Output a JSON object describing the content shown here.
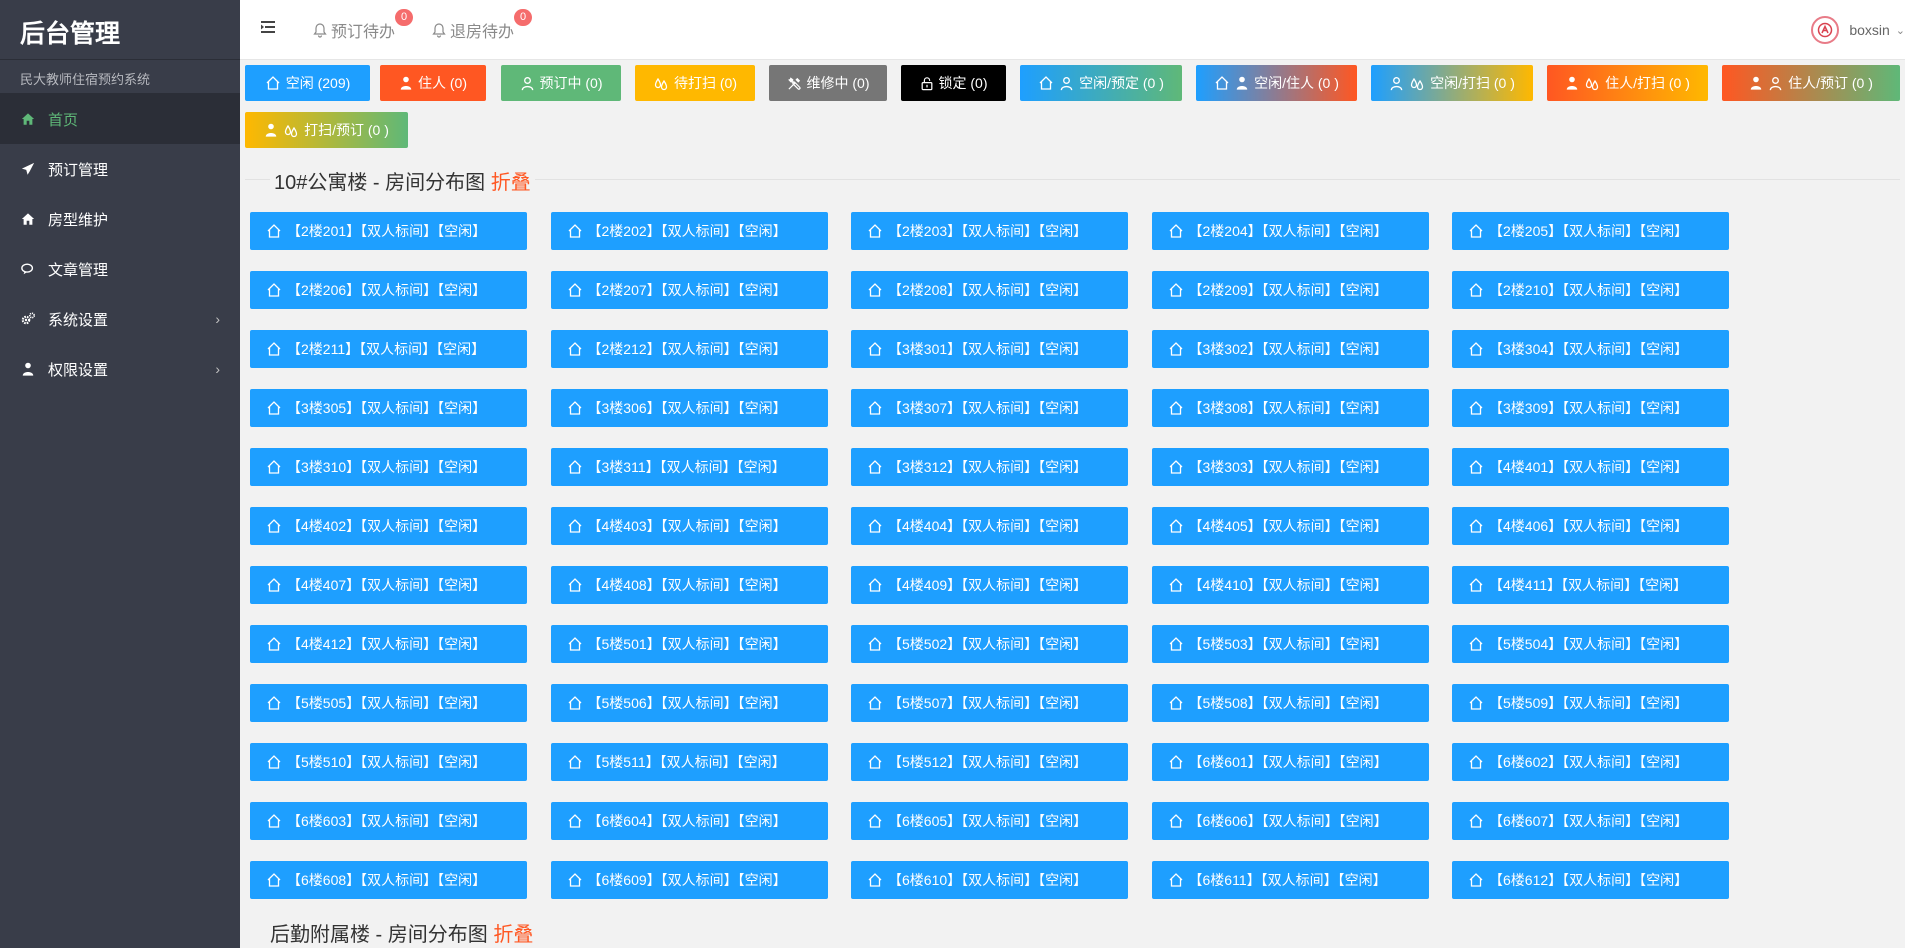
{
  "sidebar": {
    "brand": "后台管理",
    "subtitle": "民大教师住宿预约系统",
    "items": [
      {
        "label": "首页",
        "icon": "home-icon",
        "active": true,
        "has_arrow": false
      },
      {
        "label": "预订管理",
        "icon": "send-icon",
        "active": false,
        "has_arrow": false
      },
      {
        "label": "房型维护",
        "icon": "home-icon",
        "active": false,
        "has_arrow": false
      },
      {
        "label": "文章管理",
        "icon": "chat-icon",
        "active": false,
        "has_arrow": false
      },
      {
        "label": "系统设置",
        "icon": "gears-icon",
        "active": false,
        "has_arrow": true
      },
      {
        "label": "权限设置",
        "icon": "person-icon",
        "active": false,
        "has_arrow": true
      }
    ],
    "arrow": "›"
  },
  "topbar": {
    "todos": [
      {
        "label": "预订待办",
        "count": "0"
      },
      {
        "label": "退房待办",
        "count": "0"
      }
    ],
    "username": "boxsin",
    "caret": "⌄"
  },
  "legend": [
    {
      "label": "空闲 (209)",
      "icons": [
        "house-icon"
      ],
      "bg": "#1e9fff"
    },
    {
      "label": "住人 (0)",
      "icons": [
        "person-icon"
      ],
      "bg": "#ff5722"
    },
    {
      "label": "预订中 (0)",
      "icons": [
        "user-outline-icon"
      ],
      "bg": "#5fb878"
    },
    {
      "label": "待打扫 (0)",
      "icons": [
        "drops-icon"
      ],
      "bg": "#ffb800"
    },
    {
      "label": "维修中 (0)",
      "icons": [
        "tools-icon"
      ],
      "bg": "#767676"
    },
    {
      "label": "锁定 (0)",
      "icons": [
        "lock-icon"
      ],
      "bg": "#000000"
    },
    {
      "label": "空闲/预定 (0 )",
      "icons": [
        "house-icon",
        "user-outline-icon"
      ],
      "bg": "linear-gradient(to right,#1e9fff,#5fb878)"
    },
    {
      "label": "空闲/住人 (0 )",
      "icons": [
        "house-icon",
        "person-icon"
      ],
      "bg": "linear-gradient(to right,#1e9fff,#ff5722)"
    },
    {
      "label": "空闲/打扫 (0 )",
      "icons": [
        "user-outline-icon",
        "drops-icon"
      ],
      "bg": "linear-gradient(to right,#1e9fff,#ffb800)"
    },
    {
      "label": "住人/打扫 (0 )",
      "icons": [
        "person-icon",
        "drops-icon"
      ],
      "bg": "linear-gradient(to right,#ff5722,#ffb800)"
    },
    {
      "label": "住人/预订 (0 )",
      "icons": [
        "person-icon",
        "user-outline-icon"
      ],
      "bg": "linear-gradient(to right,#ff5722,#5fb878)"
    },
    {
      "label": "打扫/预订 (0 )",
      "icons": [
        "person-icon",
        "drops-icon"
      ],
      "bg": "linear-gradient(to right,#ffb800,#5fb878)"
    }
  ],
  "sections": [
    {
      "title": "10#公寓楼 - 房间分布图 ",
      "fold": "折叠"
    },
    {
      "title": "后勤附属楼 - 房间分布图 ",
      "fold": "折叠"
    }
  ],
  "rooms": [
    "【2楼201】【双人标间】【空闲】",
    "【2楼202】【双人标间】【空闲】",
    "【2楼203】【双人标间】【空闲】",
    "【2楼204】【双人标间】【空闲】",
    "【2楼205】【双人标间】【空闲】",
    "【2楼206】【双人标间】【空闲】",
    "【2楼207】【双人标间】【空闲】",
    "【2楼208】【双人标间】【空闲】",
    "【2楼209】【双人标间】【空闲】",
    "【2楼210】【双人标间】【空闲】",
    "【2楼211】【双人标间】【空闲】",
    "【2楼212】【双人标间】【空闲】",
    "【3楼301】【双人标间】【空闲】",
    "【3楼302】【双人标间】【空闲】",
    "【3楼304】【双人标间】【空闲】",
    "【3楼305】【双人标间】【空闲】",
    "【3楼306】【双人标间】【空闲】",
    "【3楼307】【双人标间】【空闲】",
    "【3楼308】【双人标间】【空闲】",
    "【3楼309】【双人标间】【空闲】",
    "【3楼310】【双人标间】【空闲】",
    "【3楼311】【双人标间】【空闲】",
    "【3楼312】【双人标间】【空闲】",
    "【3楼303】【双人标间】【空闲】",
    "【4楼401】【双人标间】【空闲】",
    "【4楼402】【双人标间】【空闲】",
    "【4楼403】【双人标间】【空闲】",
    "【4楼404】【双人标间】【空闲】",
    "【4楼405】【双人标间】【空闲】",
    "【4楼406】【双人标间】【空闲】",
    "【4楼407】【双人标间】【空闲】",
    "【4楼408】【双人标间】【空闲】",
    "【4楼409】【双人标间】【空闲】",
    "【4楼410】【双人标间】【空闲】",
    "【4楼411】【双人标间】【空闲】",
    "【4楼412】【双人标间】【空闲】",
    "【5楼501】【双人标间】【空闲】",
    "【5楼502】【双人标间】【空闲】",
    "【5楼503】【双人标间】【空闲】",
    "【5楼504】【双人标间】【空闲】",
    "【5楼505】【双人标间】【空闲】",
    "【5楼506】【双人标间】【空闲】",
    "【5楼507】【双人标间】【空闲】",
    "【5楼508】【双人标间】【空闲】",
    "【5楼509】【双人标间】【空闲】",
    "【5楼510】【双人标间】【空闲】",
    "【5楼511】【双人标间】【空闲】",
    "【5楼512】【双人标间】【空闲】",
    "【6楼601】【双人标间】【空闲】",
    "【6楼602】【双人标间】【空闲】",
    "【6楼603】【双人标间】【空闲】",
    "【6楼604】【双人标间】【空闲】",
    "【6楼605】【双人标间】【空闲】",
    "【6楼606】【双人标间】【空闲】",
    "【6楼607】【双人标间】【空闲】",
    "【6楼608】【双人标间】【空闲】",
    "【6楼609】【双人标间】【空闲】",
    "【6楼610】【双人标间】【空闲】",
    "【6楼611】【双人标间】【空闲】",
    "【6楼612】【双人标间】【空闲】"
  ],
  "colors": {
    "accent": "#1e9fff",
    "sidebar": "#393d49",
    "active_nav": "#5fb878",
    "fold": "#ff5722",
    "badge": "#f56c6c"
  }
}
